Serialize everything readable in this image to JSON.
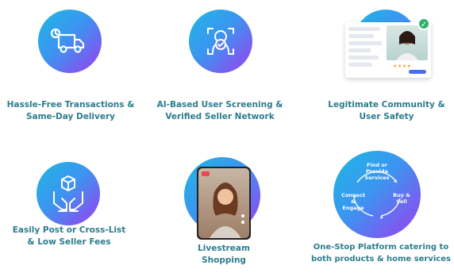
{
  "features": [
    {
      "line1": "Hassle-Free Transactions &",
      "line2": "Same-Day Delivery",
      "icon": "delivery-truck-icon"
    },
    {
      "line1": "AI-Based User Screening &",
      "line2": "Verified Seller Network",
      "icon": "face-scan-icon"
    },
    {
      "line1": "Legitimate Community &",
      "line2": "User Safety",
      "icon": "community-screenshot"
    },
    {
      "line1": "Easily Post or Cross-List",
      "line2": "& Low Seller Fees",
      "icon": "hands-package-icon"
    },
    {
      "line1": "Livestream",
      "line2": "Shopping",
      "icon": "livestream-phone"
    },
    {
      "line1": "One-Stop Platform catering to",
      "line2": "both products & home services",
      "icon": "cycle-diagram"
    }
  ],
  "cycle": {
    "top": "Find or Provide Services",
    "left": "Connect & Engage",
    "right": "Buy & Sell"
  },
  "colors": {
    "caption": "#2c7d8e",
    "gradient_start": "#1fb8e3",
    "gradient_end": "#9b4ef0"
  }
}
